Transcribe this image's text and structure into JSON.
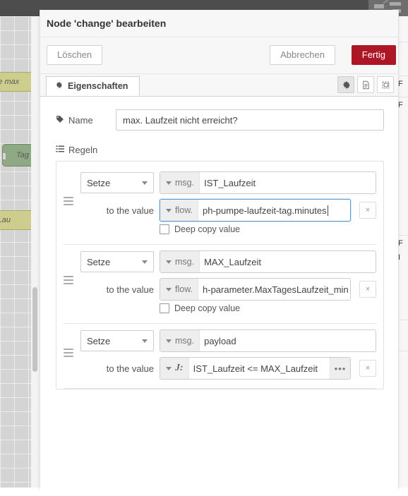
{
  "workspace": {
    "canvas_nodes": [
      {
        "label": "mpe max",
        "color": "olive"
      },
      {
        "label": "Tag",
        "color": "green"
      },
      {
        "label": "ax.Lau",
        "color": "olive"
      }
    ],
    "palette_items": [
      "F",
      "F",
      "F",
      "I"
    ]
  },
  "dialog": {
    "title": "Node 'change' bearbeiten",
    "toolbar": {
      "delete_label": "Löschen",
      "cancel_label": "Abbrechen",
      "confirm_label": "Fertig"
    },
    "tabs": [
      {
        "label": "Eigenschaften",
        "icon": "gear-icon",
        "active": true
      }
    ],
    "tab_icons": [
      {
        "name": "gear-icon",
        "active": true
      },
      {
        "name": "description-icon",
        "active": false
      },
      {
        "name": "appearance-icon",
        "active": false
      }
    ],
    "name_field": {
      "label": "Name",
      "icon": "tag-icon",
      "value": "max. Laufzeit nicht erreicht?",
      "placeholder": "Name"
    },
    "rules_section": {
      "label": "Regeln",
      "icon": "list-icon",
      "to_the_value_label": "to the value",
      "deep_copy_label": "Deep copy value",
      "remove_label": "×",
      "expand_label": "•••",
      "rules": [
        {
          "operation": "Setze",
          "property_type": "msg.",
          "property": "IST_Laufzeit",
          "value_type": "flow.",
          "value": "ph-pumpe-laufzeit-tag.minutes",
          "value_focused": true,
          "deep_copy": false,
          "has_deep_copy": true,
          "has_expand": false
        },
        {
          "operation": "Setze",
          "property_type": "msg.",
          "property": "MAX_Laufzeit",
          "value_type": "flow.",
          "value": "h-parameter.MaxTagesLaufzeit_min",
          "value_focused": false,
          "deep_copy": false,
          "has_deep_copy": true,
          "has_expand": false
        },
        {
          "operation": "Setze",
          "property_type": "msg.",
          "property": "payload",
          "value_type": "J:",
          "value": "IST_Laufzeit <= MAX_Laufzeit",
          "value_focused": false,
          "deep_copy": false,
          "has_deep_copy": false,
          "has_expand": true
        }
      ]
    }
  },
  "colors": {
    "confirm_red": "#ad1625",
    "header_dark": "#4d4d4d",
    "focus_blue": "#5b9bd5",
    "node_olive": "#cdcd8d",
    "node_green": "#8fa985"
  }
}
